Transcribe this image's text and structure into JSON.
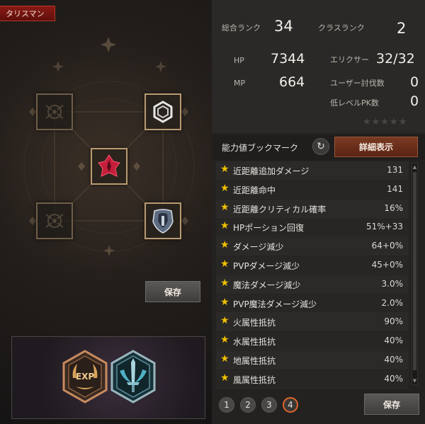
{
  "left": {
    "tab_label": "タリスマン",
    "save_label": "保存",
    "slots": [
      {
        "name": "slot-top-left",
        "icon": "empty-emblem-icon",
        "filled": false
      },
      {
        "name": "slot-top-right",
        "icon": "hexagon-ring-icon",
        "filled": true
      },
      {
        "name": "slot-center",
        "icon": "red-crest-icon",
        "filled": true
      },
      {
        "name": "slot-bottom-left",
        "icon": "empty-emblem-icon",
        "filled": false
      },
      {
        "name": "slot-bottom-right",
        "icon": "shield-icon",
        "filled": true
      }
    ],
    "badges": [
      {
        "name": "exp-badge",
        "icon": "exp-laurel-icon",
        "text": "EXP"
      },
      {
        "name": "sword-crest-badge",
        "icon": "sword-crest-icon"
      }
    ]
  },
  "stats": {
    "total_rank_label": "総合ランク",
    "total_rank_value": "34",
    "class_rank_label": "クラスランク",
    "class_rank_value": "2",
    "hp_label": "HP",
    "hp_value": "7344",
    "mp_label": "MP",
    "mp_value": "664",
    "elixir_label": "エリクサー",
    "elixir_value": "32/32",
    "user_kills_label": "ユーザー討伐数",
    "user_kills_value": "0",
    "low_pk_label": "低レベルPK数",
    "low_pk_value": "0",
    "rating_stars": 5
  },
  "bookmark": {
    "title": "能力値ブックマーク",
    "detail_button": "詳細表示",
    "rows": [
      {
        "label": "近距離追加ダメージ",
        "value": "131"
      },
      {
        "label": "近距離命中",
        "value": "141"
      },
      {
        "label": "近距離クリティカル確率",
        "value": "16%"
      },
      {
        "label": "HPポーション回復",
        "value": "51%+33"
      },
      {
        "label": "ダメージ減少",
        "value": "64+0%"
      },
      {
        "label": "PVPダメージ減少",
        "value": "45+0%"
      },
      {
        "label": "魔法ダメージ減少",
        "value": "3.0%"
      },
      {
        "label": "PVP魔法ダメージ減少",
        "value": "2.0%"
      },
      {
        "label": "火属性抵抗",
        "value": "90%"
      },
      {
        "label": "水属性抵抗",
        "value": "40%"
      },
      {
        "label": "地属性抵抗",
        "value": "40%"
      },
      {
        "label": "風属性抵抗",
        "value": "40%"
      }
    ],
    "pages": [
      "1",
      "2",
      "3",
      "4"
    ],
    "active_page": "4",
    "save_label": "保存"
  },
  "colors": {
    "accent": "#e1652a",
    "tab_red": "#8a1a14",
    "star_yellow": "#f0c000",
    "slot_gold": "#b99b72"
  }
}
